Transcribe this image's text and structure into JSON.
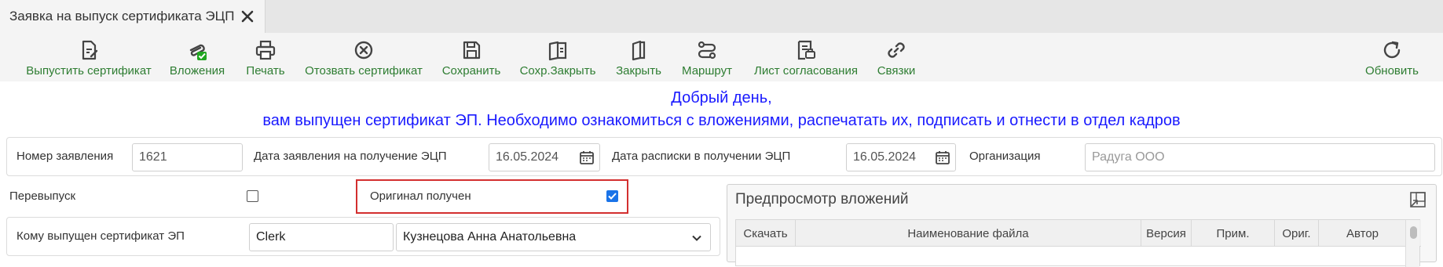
{
  "tab": {
    "title": "Заявка на выпуск сертификата ЭЦП"
  },
  "toolbar": {
    "items": [
      {
        "label": "Выпустить сертификат",
        "icon": "issue-certificate-icon"
      },
      {
        "label": "Вложения",
        "icon": "attachments-icon"
      },
      {
        "label": "Печать",
        "icon": "print-icon"
      },
      {
        "label": "Отозвать сертификат",
        "icon": "revoke-icon"
      },
      {
        "label": "Сохранить",
        "icon": "save-icon"
      },
      {
        "label": "Сохр.Закрыть",
        "icon": "save-close-icon"
      },
      {
        "label": "Закрыть",
        "icon": "close-doc-icon"
      },
      {
        "label": "Маршрут",
        "icon": "route-icon"
      },
      {
        "label": "Лист согласования",
        "icon": "approval-sheet-icon"
      },
      {
        "label": "Связки",
        "icon": "link-icon"
      },
      {
        "label": "Обновить",
        "icon": "refresh-icon"
      }
    ],
    "label_color": "#2e7d32",
    "badge_color": "#21a621"
  },
  "greeting": {
    "line1": "Добрый день,",
    "line2": "вам выпущен сертификат ЭП. Необходимо ознакомиться с вложениями, распечатать их, подписать и отнести в отдел кадров",
    "color": "#1a1aff"
  },
  "form": {
    "app_number_label": "Номер заявления",
    "app_number_value": "1621",
    "app_date_label": "Дата заявления на получение ЭЦП",
    "app_date_value": "16.05.2024",
    "receipt_date_label": "Дата расписки в получении ЭЦП",
    "receipt_date_value": "16.05.2024",
    "org_label": "Организация",
    "org_placeholder": "Радуга ООО",
    "reissue_label": "Перевыпуск",
    "reissue_checked": false,
    "original_label": "Оригинал получен",
    "original_checked": true,
    "issued_to_label": "Кому выпущен сертификат ЭП",
    "issued_to_login": "Clerk",
    "issued_to_name": "Кузнецова Анна Анатольевна"
  },
  "preview": {
    "title": "Предпросмотр вложений",
    "columns": [
      "Скачать",
      "Наименование файла",
      "Версия",
      "Прим.",
      "Ориг.",
      "Автор"
    ]
  }
}
